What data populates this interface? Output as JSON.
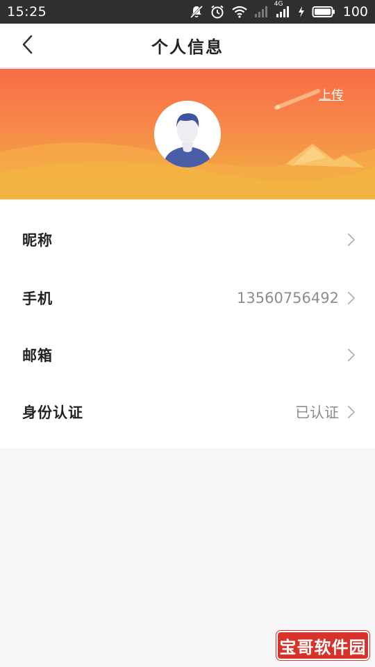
{
  "status_bar": {
    "time": "15:25",
    "network_label": "4G",
    "battery_level": "100",
    "icons": [
      "mute-icon",
      "alarm-icon",
      "wifi-icon",
      "signal-icon",
      "signal-4g-icon",
      "charging-icon",
      "battery-icon"
    ]
  },
  "nav": {
    "title": "个人信息",
    "back_icon": "chevron-left-icon"
  },
  "banner": {
    "upload_label": "上传",
    "colors": {
      "top": "#f86c47",
      "bottom": "#f0b23c"
    }
  },
  "profile_rows": [
    {
      "label": "昵称",
      "value": ""
    },
    {
      "label": "手机",
      "value": "13560756492"
    },
    {
      "label": "邮箱",
      "value": ""
    },
    {
      "label": "身份认证",
      "value": "已认证"
    }
  ],
  "watermark": {
    "text": "宝哥软件园",
    "color": "#d8332a"
  }
}
